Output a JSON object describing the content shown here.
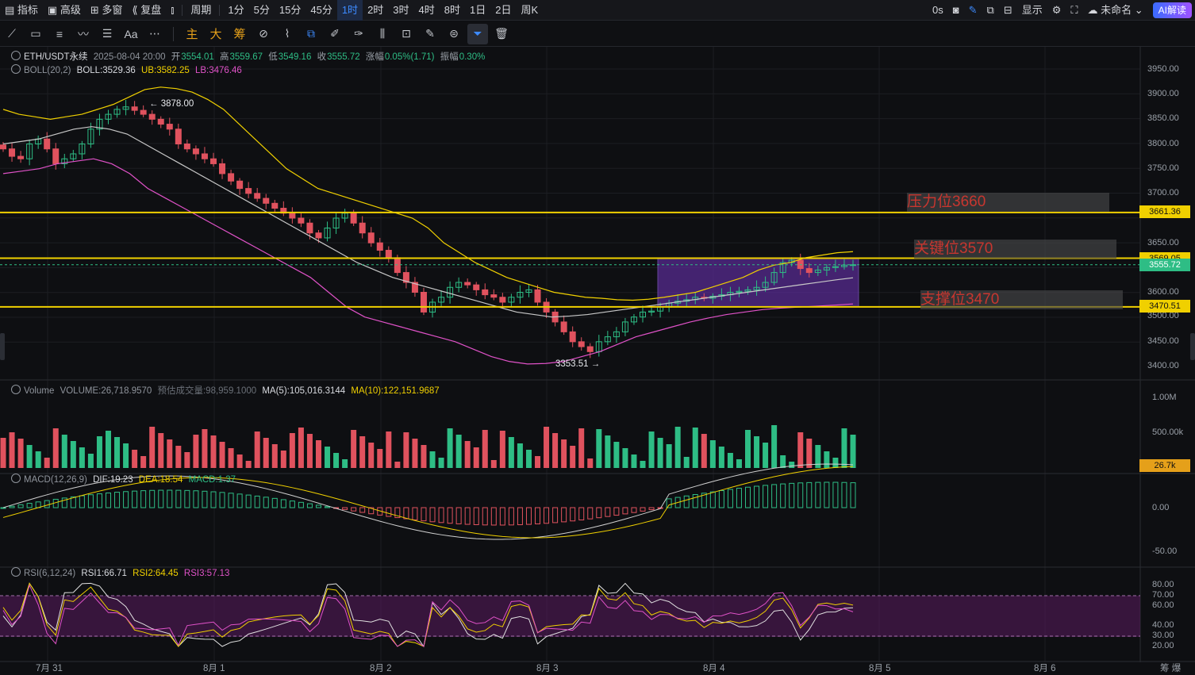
{
  "topbar": {
    "items": [
      "指标",
      "高级",
      "多窗",
      "复盘",
      "",
      "周期",
      "1分",
      "5分",
      "15分",
      "45分",
      "1时",
      "2时",
      "3时",
      "4时",
      "8时",
      "1日",
      "2日",
      "周K"
    ],
    "active_interval": "1时",
    "right": {
      "latency": "0s",
      "display": "显示",
      "layout_name": "未命名",
      "ai_button": "AI解读"
    }
  },
  "toolbar": {
    "cn_tools": [
      "主",
      "大",
      "筹"
    ],
    "text_tool": "Aa"
  },
  "main_legend": {
    "symbol": "ETH/USDT永续",
    "datetime": "2025-08-04 20:00",
    "open_label": "开",
    "open": "3554.01",
    "high_label": "高",
    "high": "3559.67",
    "low_label": "低",
    "low": "3549.16",
    "close_label": "收",
    "close": "3555.72",
    "change_label": "涨幅",
    "change": "0.05%(1.71)",
    "amp_label": "振幅",
    "amp": "0.30%"
  },
  "boll_legend": {
    "name": "BOLL(20,2)",
    "boll": "BOLL:3529.36",
    "ub": "UB:3582.25",
    "lb": "LB:3476.46"
  },
  "volume_legend": {
    "name": "Volume",
    "volume": "VOLUME:26,718.9570",
    "est": "预估成交量:98,959.1000",
    "ma5": "MA(5):105,016.3144",
    "ma10": "MA(10):122,151.9687"
  },
  "macd_legend": {
    "name": "MACD(12,26,9)",
    "dif": "DIF:19.23",
    "dea": "DEA:18.54",
    "macd": "MACD:1.37"
  },
  "rsi_legend": {
    "name": "RSI(6,12,24)",
    "rsi1": "RSI1:66.71",
    "rsi2": "RSI2:64.45",
    "rsi3": "RSI3:57.13"
  },
  "price_axis": [
    "3950.00",
    "3900.00",
    "3850.00",
    "3800.00",
    "3750.00",
    "3700.00",
    "3650.00",
    "3600.00",
    "3500.00",
    "3450.00",
    "3400.00",
    "3350.00"
  ],
  "price_tags": {
    "pressure": "3661.36",
    "key": "3569.05",
    "current": "3555.72",
    "support": "3470.51"
  },
  "volume_axis": [
    "1.00M",
    "500.00k"
  ],
  "volume_tag": "26.7k",
  "macd_axis": [
    "0.00",
    "-50.00"
  ],
  "rsi_axis": [
    "80.00",
    "70.00",
    "60.00",
    "40.00",
    "30.00",
    "20.00"
  ],
  "x_axis": [
    "7月 31",
    "8月 1",
    "8月 2",
    "8月 3",
    "8月 4",
    "8月 5",
    "8月 6"
  ],
  "x_axis_end": "筹 爆",
  "annotations": {
    "high": "3878.00",
    "low": "3353.51"
  },
  "zones": {
    "pressure": "压力位3660",
    "key": "关键位3570",
    "support": "支撑位3470"
  },
  "colors": {
    "up": "#2ebd85",
    "down": "#e0525e",
    "line_level": "#f0d000",
    "boll_mid": "#c8c8c8",
    "boll_upper": "#f0d000",
    "boll_lower": "#e052c8",
    "rsi_band": "#5a1c5e",
    "box": "#5b2c99"
  },
  "chart_data": {
    "type": "line",
    "symbol": "ETH/USDT永续",
    "interval": "1时",
    "close_series": [
      3790,
      3775,
      3770,
      3800,
      3810,
      3790,
      3760,
      3770,
      3780,
      3800,
      3830,
      3850,
      3860,
      3870,
      3875,
      3868,
      3860,
      3850,
      3840,
      3830,
      3800,
      3790,
      3780,
      3770,
      3760,
      3740,
      3725,
      3710,
      3700,
      3690,
      3680,
      3670,
      3660,
      3650,
      3640,
      3620,
      3610,
      3630,
      3650,
      3660,
      3640,
      3620,
      3600,
      3585,
      3570,
      3540,
      3520,
      3500,
      3460,
      3480,
      3490,
      3510,
      3520,
      3515,
      3505,
      3495,
      3490,
      3480,
      3490,
      3500,
      3505,
      3480,
      3460,
      3440,
      3420,
      3400,
      3390,
      3380,
      3400,
      3410,
      3420,
      3440,
      3450,
      3460,
      3462,
      3470,
      3478,
      3482,
      3485,
      3490,
      3488,
      3492,
      3495,
      3500,
      3502,
      3505,
      3510,
      3520,
      3540,
      3560,
      3565,
      3548,
      3540,
      3545,
      3550,
      3552,
      3555,
      3555.72
    ],
    "boll_upper": [
      3870,
      3860,
      3855,
      3850,
      3855,
      3860,
      3870,
      3880,
      3895,
      3910,
      3915,
      3912,
      3905,
      3890,
      3870,
      3840,
      3810,
      3780,
      3750,
      3730,
      3710,
      3700,
      3690,
      3680,
      3670,
      3660,
      3650,
      3630,
      3600,
      3580,
      3560,
      3545,
      3530,
      3520,
      3510,
      3500,
      3495,
      3490,
      3488,
      3485,
      3484,
      3486,
      3490,
      3495,
      3500,
      3510,
      3520,
      3530,
      3545,
      3555,
      3560,
      3570,
      3575,
      3580,
      3582.25
    ],
    "boll_mid": [
      3800,
      3805,
      3810,
      3820,
      3830,
      3835,
      3830,
      3820,
      3800,
      3780,
      3760,
      3740,
      3720,
      3700,
      3680,
      3660,
      3640,
      3620,
      3600,
      3580,
      3560,
      3545,
      3530,
      3520,
      3510,
      3500,
      3490,
      3480,
      3470,
      3460,
      3455,
      3450,
      3452,
      3455,
      3460,
      3465,
      3470,
      3475,
      3480,
      3485,
      3490,
      3495,
      3500,
      3505,
      3510,
      3515,
      3520,
      3525,
      3529.36
    ],
    "boll_lower": [
      3740,
      3745,
      3750,
      3760,
      3765,
      3770,
      3760,
      3740,
      3710,
      3690,
      3670,
      3650,
      3630,
      3610,
      3590,
      3570,
      3550,
      3530,
      3500,
      3470,
      3450,
      3440,
      3430,
      3420,
      3410,
      3400,
      3385,
      3370,
      3360,
      3355,
      3356,
      3360,
      3370,
      3380,
      3395,
      3410,
      3420,
      3430,
      3440,
      3448,
      3455,
      3460,
      3465,
      3468,
      3470,
      3472,
      3474,
      3476.46
    ],
    "levels": [
      3661.36,
      3569.05,
      3470.51
    ],
    "ylim": [
      3330,
      3975
    ],
    "high_marker": 3878.0,
    "low_marker": 3353.51
  }
}
